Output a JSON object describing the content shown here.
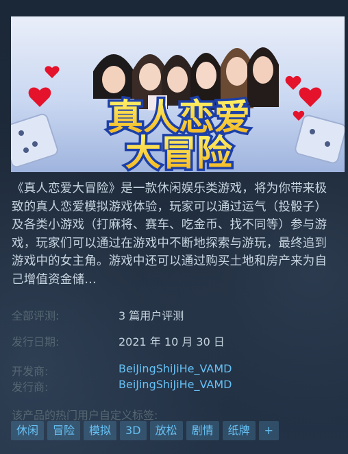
{
  "capsule": {
    "title_line1": "真人恋爱",
    "title_line2": "大冒险"
  },
  "description": "《真人恋爱大冒险》是一款休闲娱乐类游戏，将为你带来极致的真人恋爱模拟游戏体验，玩家可以通过运气（投骰子）及各类小游戏（打麻将、赛车、吃金币、找不同等）参与游戏，玩家们可以通过在游戏中不断地探索与游玩，最终追到游戏中的女主角。游戏中还可以通过购买土地和房产来为自己增值资金储…",
  "reviews": {
    "label": "全部评测:",
    "value": "3 篇用户评测"
  },
  "release": {
    "label": "发行日期:",
    "value": "2021 年 10 月 30 日"
  },
  "developer": {
    "label": "开发商:",
    "value": "BeiJingShiJiHe_VAMD"
  },
  "publisher": {
    "label": "发行商:",
    "value": "BeiJingShiJiHe_VAMD"
  },
  "tags_label": "该产品的热门用户自定义标签:",
  "tags": [
    "休闲",
    "冒险",
    "模拟",
    "3D",
    "放松",
    "剧情",
    "纸牌",
    "+"
  ]
}
